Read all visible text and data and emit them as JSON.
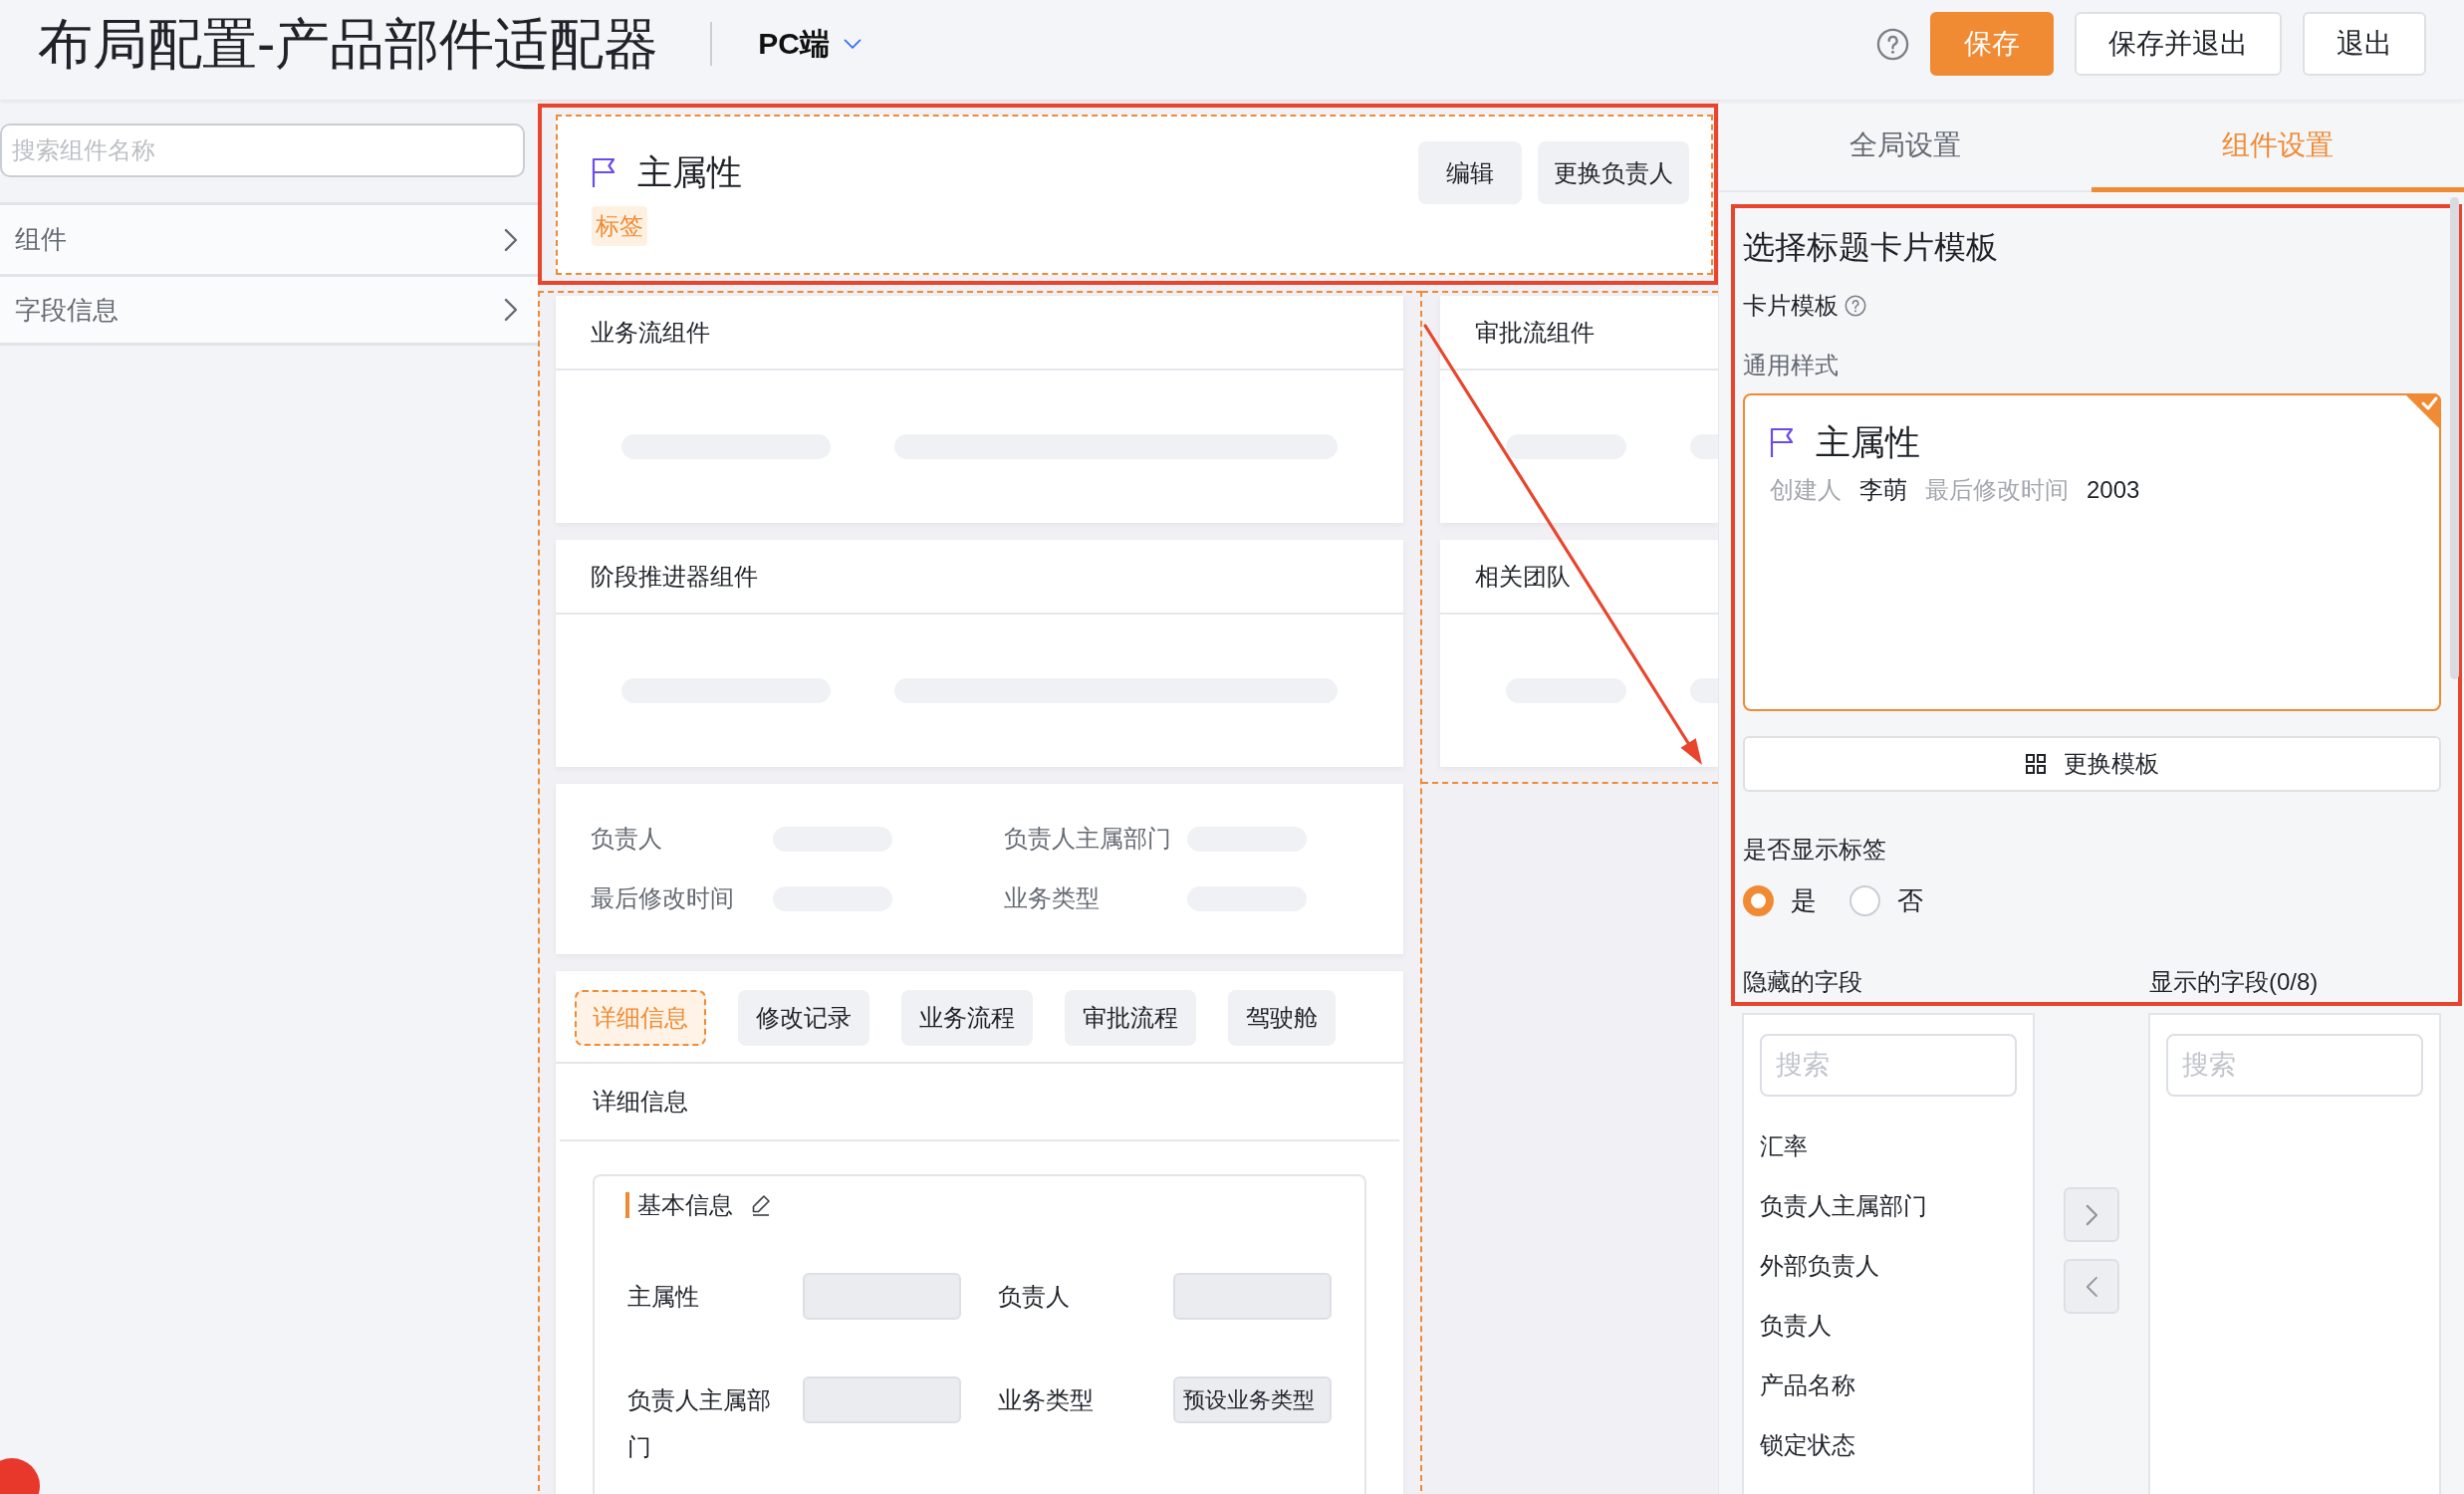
{
  "header": {
    "title": "布局配置-产品部件适配器",
    "platform": "PC端",
    "buttons": [
      {
        "label": "保存",
        "kind": "primary"
      },
      {
        "label": "保存并退出",
        "kind": "default"
      },
      {
        "label": "退出",
        "kind": "default"
      }
    ]
  },
  "sidebar": {
    "search": {
      "placeholder": "搜索组件名称"
    },
    "items": [
      {
        "label": "组件",
        "expanded": false
      },
      {
        "label": "字段信息",
        "expanded": false
      }
    ]
  },
  "canvas": {
    "header_card": {
      "title": "主属性",
      "tag": "标签",
      "actions": [
        "编辑",
        "更换负责人"
      ]
    },
    "main_column": [
      {
        "kind": "section",
        "title": "业务流组件"
      },
      {
        "kind": "section",
        "title": "阶段推进器组件"
      },
      {
        "kind": "fields",
        "fields": [
          "负责人",
          "负责人主属部门",
          "最后修改时间",
          "业务类型"
        ]
      },
      {
        "kind": "tabs",
        "tabs": [
          {
            "label": "详细信息",
            "selected": true
          },
          {
            "label": "修改记录",
            "selected": false
          },
          {
            "label": "业务流程",
            "selected": false
          },
          {
            "label": "审批流程",
            "selected": false
          },
          {
            "label": "驾驶舱",
            "selected": false
          }
        ],
        "panel_title": "详细信息",
        "group": {
          "title": "基本信息",
          "fields": [
            {
              "label": "主属性"
            },
            {
              "label": "负责人"
            },
            {
              "label": "负责人主属部门"
            },
            {
              "label": "业务类型",
              "value": "预设业务类型"
            }
          ]
        }
      }
    ],
    "side_column": [
      {
        "title": "审批流组件"
      },
      {
        "title": "相关团队"
      }
    ]
  },
  "settings": {
    "tabs": [
      {
        "label": "全局设置",
        "selected": false
      },
      {
        "label": "组件设置",
        "selected": true
      }
    ],
    "heading": "选择标题卡片模板",
    "template_label": "卡片模板",
    "style_label": "通用样式",
    "template_card": {
      "title": "主属性",
      "selected": true,
      "meta": [
        {
          "label": "创建人",
          "value": "李萌"
        },
        {
          "label": "最后修改时间",
          "value": "2003"
        }
      ]
    },
    "change_button": "更换模板",
    "show_tag": {
      "label": "是否显示标签",
      "options": [
        {
          "label": "是",
          "selected": true
        },
        {
          "label": "否",
          "selected": false
        }
      ]
    },
    "hidden_fields": {
      "title": "隐藏的字段",
      "search": {
        "placeholder": "搜索"
      },
      "items": [
        "汇率",
        "负责人主属部门",
        "外部负责人",
        "负责人",
        "产品名称",
        "锁定状态"
      ]
    },
    "shown_fields": {
      "title": "显示的字段(0/8)",
      "search": {
        "placeholder": "搜索"
      }
    }
  }
}
